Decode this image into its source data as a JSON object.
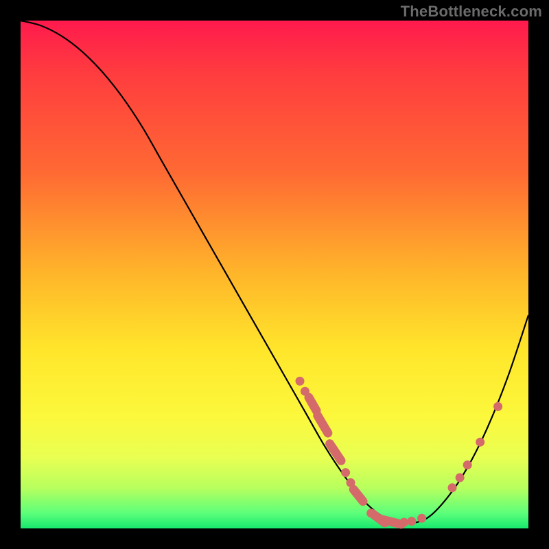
{
  "watermark": "TheBottleneck.com",
  "colors": {
    "background": "#000000",
    "gradient_top": "#ff1a4d",
    "gradient_mid": "#ffe62b",
    "gradient_bottom": "#18e86e",
    "curve": "#000000",
    "marker": "#d46a6a"
  },
  "chart_data": {
    "type": "line",
    "title": "",
    "xlabel": "",
    "ylabel": "",
    "xlim": [
      0,
      100
    ],
    "ylim": [
      0,
      100
    ],
    "grid": false,
    "series": [
      {
        "name": "bottleneck-curve",
        "x": [
          0,
          4,
          8,
          12,
          16,
          20,
          24,
          28,
          32,
          36,
          40,
          44,
          48,
          52,
          56,
          60,
          64,
          68,
          72,
          76,
          80,
          84,
          88,
          92,
          96,
          100
        ],
        "values": [
          100,
          99,
          97,
          94,
          90,
          85,
          79,
          72,
          65,
          58,
          51,
          44,
          37,
          30,
          23,
          16,
          10,
          5,
          2,
          1,
          2,
          6,
          12,
          20,
          30,
          42
        ]
      }
    ],
    "markers": [
      {
        "x": 55,
        "y": 29,
        "shape": "dot"
      },
      {
        "x": 56,
        "y": 27,
        "shape": "dot"
      },
      {
        "x": 57.5,
        "y": 24.5,
        "shape": "pill",
        "len": 3
      },
      {
        "x": 59.5,
        "y": 20.5,
        "shape": "pill",
        "len": 4
      },
      {
        "x": 62,
        "y": 15,
        "shape": "pill",
        "len": 4
      },
      {
        "x": 64,
        "y": 11,
        "shape": "dot"
      },
      {
        "x": 65,
        "y": 9,
        "shape": "dot"
      },
      {
        "x": 66.5,
        "y": 6.5,
        "shape": "pill",
        "len": 3
      },
      {
        "x": 69,
        "y": 3,
        "shape": "dot"
      },
      {
        "x": 70.5,
        "y": 2,
        "shape": "pill",
        "len": 3
      },
      {
        "x": 73,
        "y": 1.3,
        "shape": "pill",
        "len": 4
      },
      {
        "x": 75.5,
        "y": 1.2,
        "shape": "dot"
      },
      {
        "x": 77,
        "y": 1.4,
        "shape": "dot"
      },
      {
        "x": 79,
        "y": 2,
        "shape": "dot"
      },
      {
        "x": 85,
        "y": 8,
        "shape": "dot"
      },
      {
        "x": 86.5,
        "y": 10,
        "shape": "dot"
      },
      {
        "x": 88,
        "y": 12.5,
        "shape": "dot"
      },
      {
        "x": 90.5,
        "y": 17,
        "shape": "dot"
      },
      {
        "x": 94,
        "y": 24,
        "shape": "dot"
      }
    ]
  }
}
